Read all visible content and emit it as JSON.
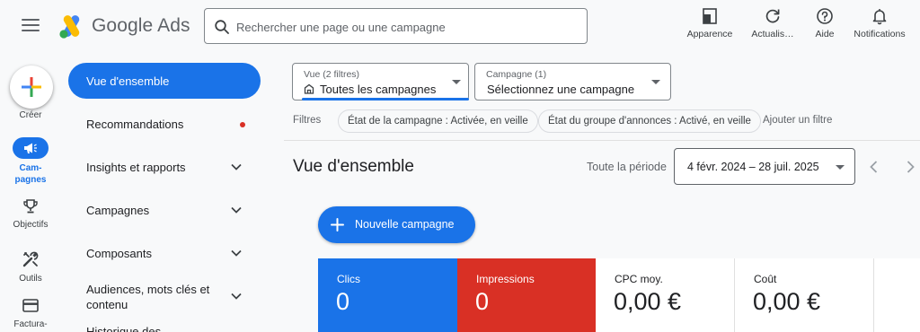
{
  "colors": {
    "primary": "#1a73e8",
    "impressions": "#d93025",
    "alert_dot": "#d93025",
    "text": "#202124",
    "muted": "#5f6368"
  },
  "header": {
    "brand": "Google Ads",
    "search_placeholder": "Rechercher une page ou une campagne",
    "actions": [
      {
        "label": "Apparence",
        "icon": "appearance-icon"
      },
      {
        "label": "Actualis…",
        "icon": "refresh-icon"
      },
      {
        "label": "Aide",
        "icon": "help-icon"
      },
      {
        "label": "Notifications",
        "icon": "bell-icon"
      }
    ]
  },
  "rail": {
    "create": "Créer",
    "campaigns": "Cam-\npagnes",
    "goals": "Objectifs",
    "tools": "Outils",
    "billing": "Factura-"
  },
  "nav": {
    "overview": "Vue d'ensemble",
    "recommendations": "Recommandations",
    "insights": "Insights et rapports",
    "campaigns": "Campagnes",
    "assets": "Composants",
    "audiences": "Audiences, mots clés et contenu",
    "history": "Historique des"
  },
  "filters": {
    "view_label": "Vue (2 filtres)",
    "view_value": "Toutes les campagnes",
    "campaign_label": "Campagne (1)",
    "campaign_value": "Sélectionnez une campagne",
    "filters_label": "Filtres",
    "chip_campaign_status": "État de la campagne : Activée, en veille",
    "chip_adgroup_status": "État du groupe d'annonces : Activé, en veille",
    "add_filter": "Ajouter un filtre"
  },
  "main": {
    "title": "Vue d'ensemble",
    "period_label": "Toute la période",
    "date_range": "4 févr. 2024 – 28 juil. 2025",
    "new_campaign": "Nouvelle campagne"
  },
  "metrics": [
    {
      "label": "Clics",
      "value": "0"
    },
    {
      "label": "Impressions",
      "value": "0"
    },
    {
      "label": "CPC moy.",
      "value": "0,00 €"
    },
    {
      "label": "Coût",
      "value": "0,00 €"
    }
  ]
}
